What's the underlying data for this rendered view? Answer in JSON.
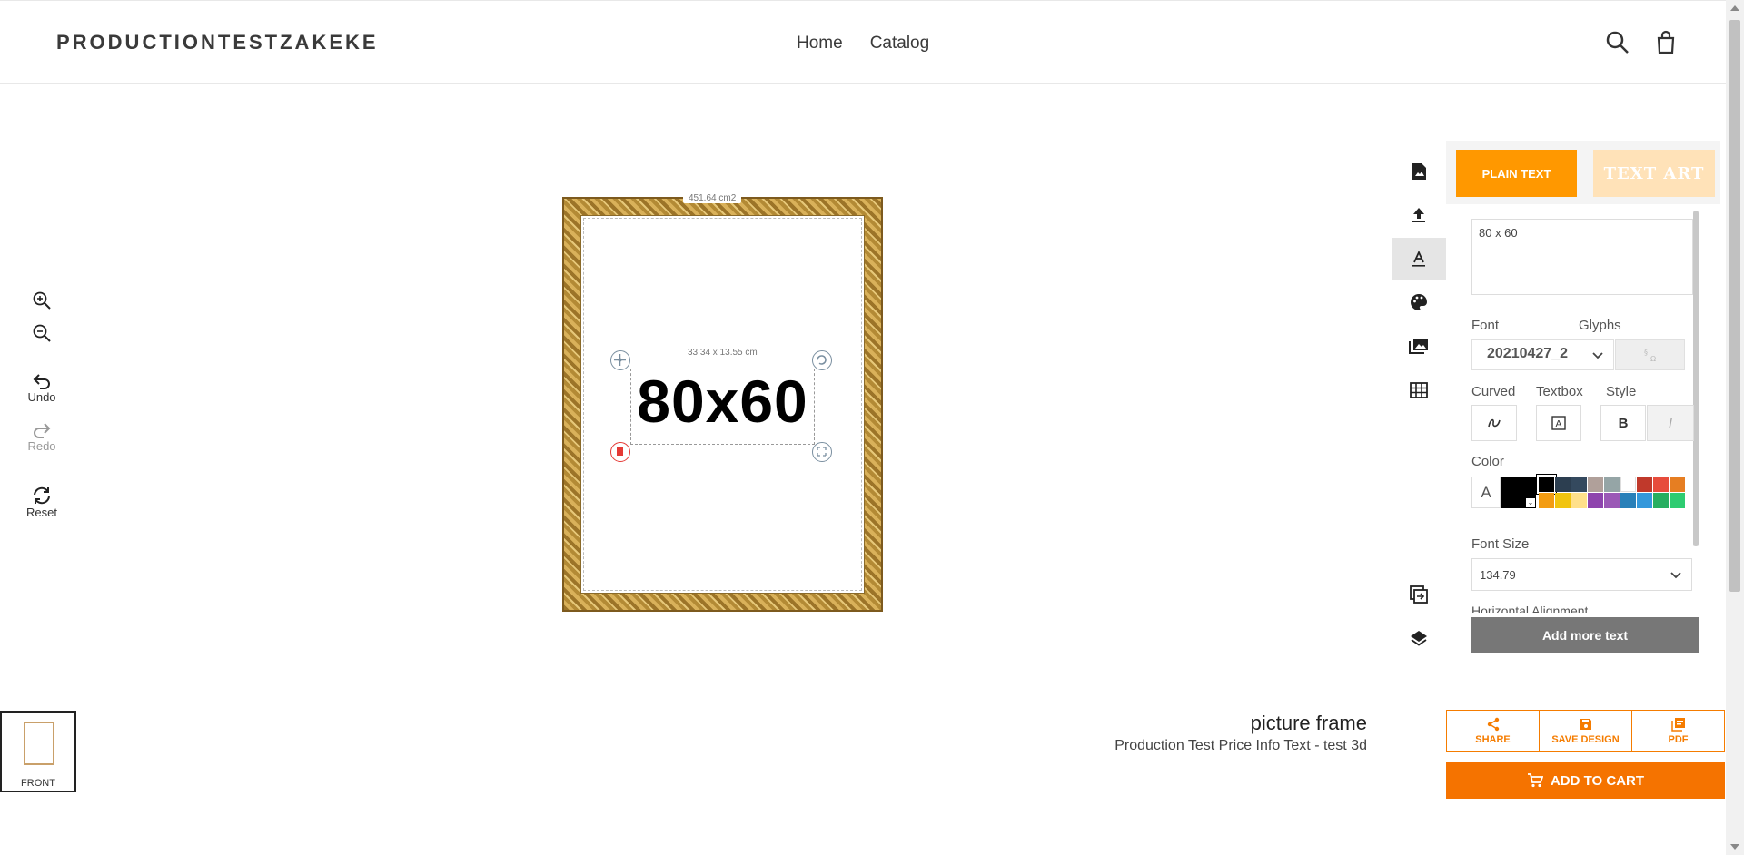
{
  "header": {
    "logo": "PRODUCTIONTESTZAKEKE",
    "nav": [
      {
        "label": "Home"
      },
      {
        "label": "Catalog"
      }
    ]
  },
  "left_tools": {
    "undo": "Undo",
    "redo": "Redo",
    "reset": "Reset"
  },
  "canvas": {
    "area_label": "451.64 cm2",
    "selection_dims": "33.34 x 13.55 cm",
    "text": "80x60"
  },
  "panel": {
    "tab_plain": "PLAIN TEXT",
    "tab_art": "TEXT ART",
    "text_value": "80 x 60",
    "font_label": "Font",
    "glyphs_label": "Glyphs",
    "font_value": "20210427_2",
    "curved_label": "Curved",
    "textbox_label": "Textbox",
    "style_label": "Style",
    "color_label": "Color",
    "color_a": "A",
    "bold": "B",
    "italic": "I",
    "font_size_label": "Font Size",
    "font_size_value": "134.79",
    "halign_label": "Horizontal Alignment",
    "add_more": "Add more text",
    "swatches": [
      "#000000",
      "#2c3e50",
      "#34495e",
      "#b0a09a",
      "#95a5a6",
      "#ffffff",
      "#c0392b",
      "#e74c3c",
      "#e67e22",
      "#f39c12",
      "#f1c40f",
      "#ffe08a",
      "#8e44ad",
      "#9b59b6",
      "#2980b9",
      "#3498db",
      "#27ae60",
      "#2ecc71"
    ]
  },
  "bottom": {
    "thumb_label": "FRONT",
    "product_name": "picture frame",
    "product_info": "Production Test Price Info Text - test 3d",
    "share": "SHARE",
    "save_design": "SAVE DESIGN",
    "pdf": "PDF",
    "add_to_cart": "ADD TO CART"
  },
  "colors": {
    "accent": "#f57300",
    "tab_active": "#ff9800"
  }
}
